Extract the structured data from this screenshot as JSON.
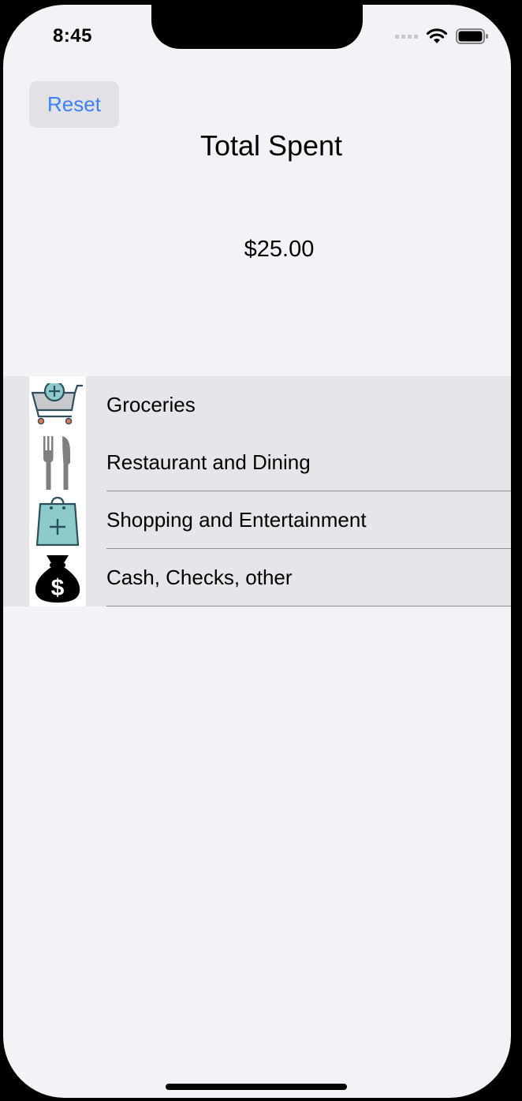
{
  "status_bar": {
    "time": "8:45"
  },
  "toolbar": {
    "reset_label": "Reset"
  },
  "header": {
    "title": "Total Spent"
  },
  "summary": {
    "total_amount": "$25.00"
  },
  "categories": [
    {
      "label": "Groceries",
      "icon": "shopping-cart-add-icon"
    },
    {
      "label": "Restaurant and Dining",
      "icon": "fork-knife-icon"
    },
    {
      "label": "Shopping and Entertainment",
      "icon": "shopping-bag-add-icon"
    },
    {
      "label": "Cash, Checks, other",
      "icon": "money-bag-icon"
    }
  ],
  "colors": {
    "accent": "#3a82f6",
    "background": "#f2f2f7",
    "row_background": "#e5e5ea",
    "teal_icon": "#8ccbc9"
  }
}
